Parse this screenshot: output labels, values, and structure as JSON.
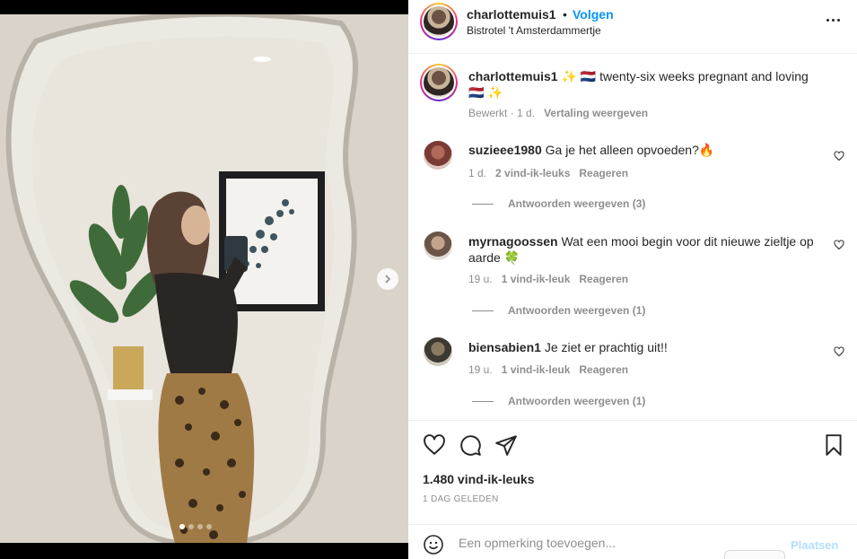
{
  "post": {
    "username": "charlottemuis1",
    "separator": "•",
    "follow_label": "Volgen",
    "location": "Bistrotel 't Amsterdammertje",
    "caption_username": "charlottemuis1",
    "caption_text": "✨ 🇳🇱 twenty-six weeks pregnant and loving 🇳🇱 ✨",
    "caption_edited": "Bewerkt",
    "caption_age": "· 1 d.",
    "caption_translation": "Vertaling weergeven"
  },
  "comments": [
    {
      "username": "suzieee1980",
      "text": "Ga je het alleen opvoeden?🔥",
      "age": "1 d.",
      "likes": "2 vind-ik-leuks",
      "reply_label": "Reageren",
      "view_replies": "Antwoorden weergeven (3)"
    },
    {
      "username": "myrnagoossen",
      "text": "Wat een mooi begin voor dit nieuwe zieltje op aarde 🍀",
      "age": "19 u.",
      "likes": "1 vind-ik-leuk",
      "reply_label": "Reageren",
      "view_replies": "Antwoorden weergeven (1)"
    },
    {
      "username": "biensabien1",
      "text": "Je ziet er prachtig uit!!",
      "age": "19 u.",
      "likes": "1 vind-ik-leuk",
      "reply_label": "Reageren",
      "view_replies": "Antwoorden weergeven (1)"
    }
  ],
  "stats": {
    "likes": "1.480 vind-ik-leuks",
    "date": "1 DAG GELEDEN"
  },
  "add_comment": {
    "placeholder": "Een opmerking toevoegen...",
    "post_label": "Plaatsen"
  },
  "colors": {
    "accent": "#0095f6",
    "post_button_disabled": "#b2dffc",
    "secondary_text": "#8e8e8e"
  },
  "icons": [
    "more-options-icon",
    "heart-icon",
    "comment-icon",
    "share-icon",
    "bookmark-icon",
    "emoji-icon",
    "chevron-right-icon"
  ]
}
